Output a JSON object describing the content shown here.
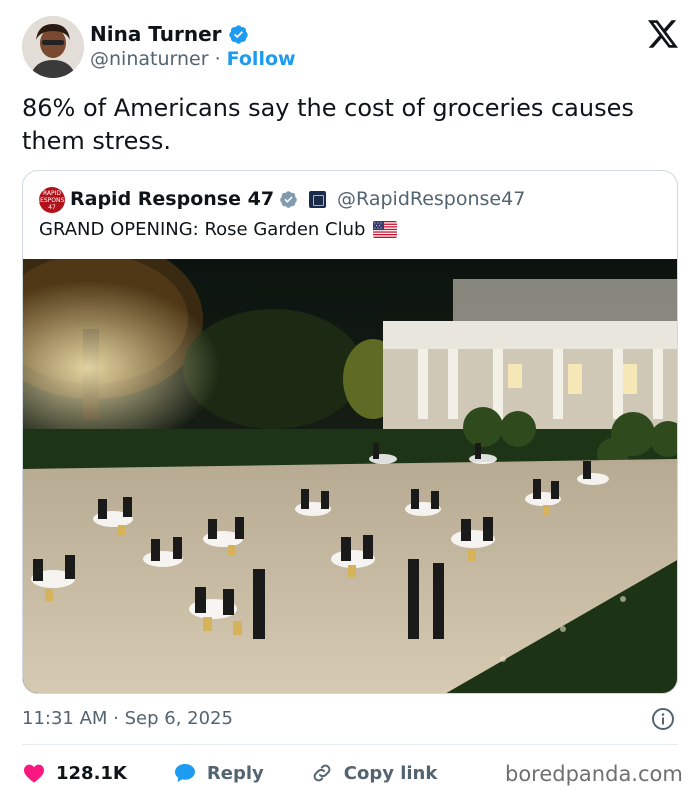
{
  "author": {
    "name": "Nina Turner",
    "handle": "@ninaturner",
    "separator": "·",
    "follow_label": "Follow",
    "avatar_icon": "person-avatar"
  },
  "tweet": {
    "text": "86% of Americans say the cost of groceries causes them stress."
  },
  "quote": {
    "name": "Rapid Response 47",
    "handle": "@RapidResponse47",
    "avatar_text": "RAPID RESPONSE 47",
    "text": "GRAND OPENING: Rose Garden Club",
    "flag_icon": "us-flag-icon",
    "photo": "night-photo-rose-garden-dinner"
  },
  "footer": {
    "timestamp": "11:31 AM · Sep 6, 2025",
    "likes": "128.1K",
    "reply_label": "Reply",
    "copy_label": "Copy link"
  },
  "watermark": "boredpanda.com",
  "colors": {
    "accent": "#1d9bf0",
    "like": "#f91880",
    "muted": "#536471",
    "text": "#0f1419",
    "border": "#cfd9de"
  }
}
